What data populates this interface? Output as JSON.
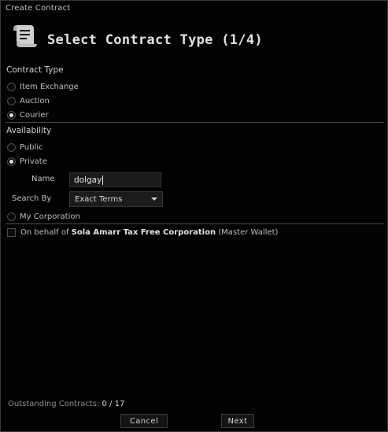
{
  "window": {
    "title": "Create Contract"
  },
  "header": {
    "icon": "contract-scroll-icon",
    "title": "Select Contract Type (1/4)"
  },
  "contract_type": {
    "label": "Contract Type",
    "options": [
      {
        "label": "Item Exchange",
        "checked": false
      },
      {
        "label": "Auction",
        "checked": false
      },
      {
        "label": "Courier",
        "checked": true
      }
    ]
  },
  "availability": {
    "label": "Availability",
    "options": [
      {
        "label": "Public",
        "checked": false
      },
      {
        "label": "Private",
        "checked": true
      }
    ],
    "name_label": "Name",
    "name_value": "dolgay",
    "search_by_label": "Search By",
    "search_by_value": "Exact Terms",
    "corporation_option": {
      "label": "My Corporation",
      "checked": false
    }
  },
  "on_behalf": {
    "prefix": "On behalf of",
    "corporation": "Sola Amarr Tax Free Corporation",
    "suffix": "(Master Wallet)",
    "checked": false
  },
  "footer": {
    "outstanding_label": "Outstanding Contracts:",
    "outstanding_value": "0 / 17",
    "cancel_label": "Cancel",
    "next_label": "Next"
  }
}
